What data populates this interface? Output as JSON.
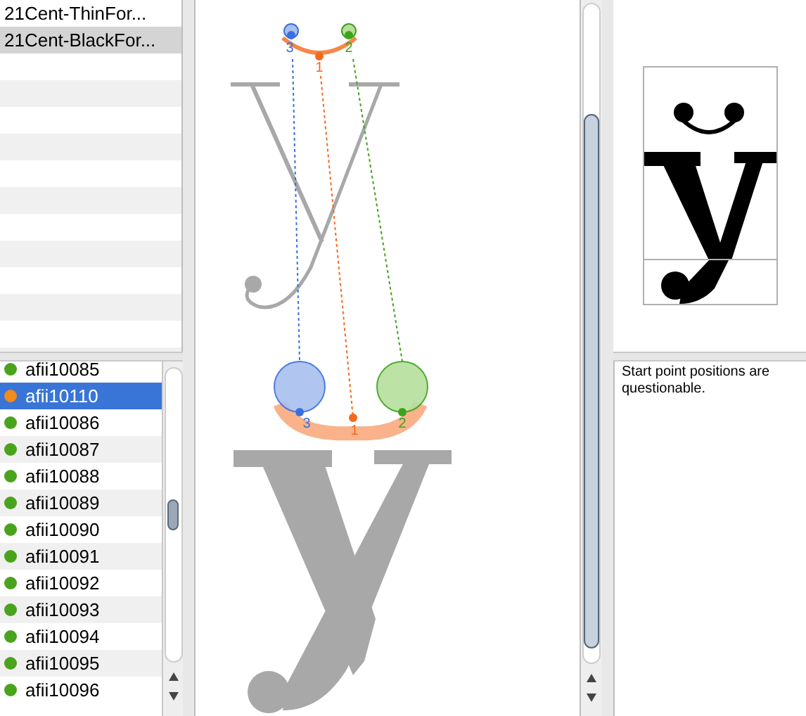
{
  "fonts": [
    {
      "name": "21Cent-ThinFor...",
      "selected": false
    },
    {
      "name": "21Cent-BlackFor...",
      "selected": true
    }
  ],
  "glyphs": [
    {
      "name": "afii10085",
      "color": "#4aa31c",
      "selected": false
    },
    {
      "name": "afii10110",
      "color": "#f28a1c",
      "selected": true
    },
    {
      "name": "afii10086",
      "color": "#4aa31c",
      "selected": false
    },
    {
      "name": "afii10087",
      "color": "#4aa31c",
      "selected": false
    },
    {
      "name": "afii10088",
      "color": "#4aa31c",
      "selected": false
    },
    {
      "name": "afii10089",
      "color": "#4aa31c",
      "selected": false
    },
    {
      "name": "afii10090",
      "color": "#4aa31c",
      "selected": false
    },
    {
      "name": "afii10091",
      "color": "#4aa31c",
      "selected": false
    },
    {
      "name": "afii10092",
      "color": "#4aa31c",
      "selected": false
    },
    {
      "name": "afii10093",
      "color": "#4aa31c",
      "selected": false
    },
    {
      "name": "afii10094",
      "color": "#4aa31c",
      "selected": false
    },
    {
      "name": "afii10095",
      "color": "#4aa31c",
      "selected": false
    },
    {
      "name": "afii10096",
      "color": "#4aa31c",
      "selected": false
    }
  ],
  "canvas": {
    "top_labels": [
      {
        "text": "3",
        "color": "#3b6fe0"
      },
      {
        "text": "1",
        "color": "#f26a1c"
      },
      {
        "text": "2",
        "color": "#3ca31c"
      }
    ],
    "bottom_labels": [
      {
        "text": "3",
        "color": "#3b6fe0"
      },
      {
        "text": "1",
        "color": "#f26a1c"
      },
      {
        "text": "2",
        "color": "#3ca31c"
      }
    ]
  },
  "note": {
    "text": "Start point positions are questionable."
  }
}
